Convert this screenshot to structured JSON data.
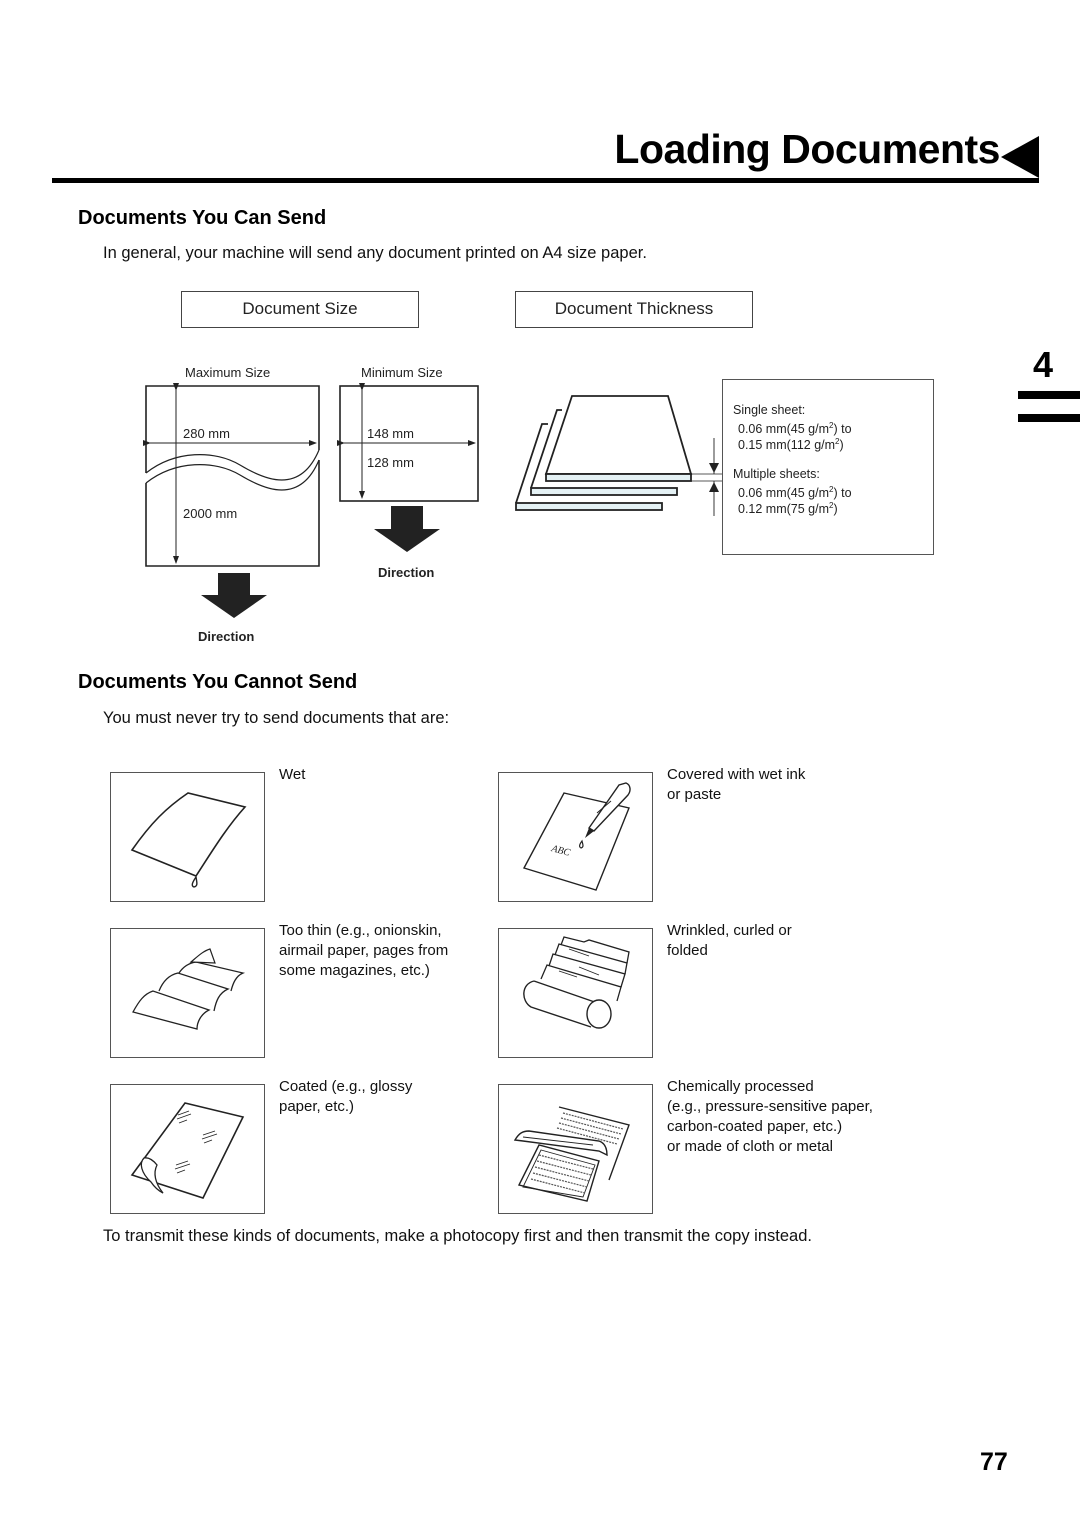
{
  "header": {
    "title": "Loading Documents",
    "chapter_tab": "4"
  },
  "section_can_send": {
    "heading": "Documents You Can Send",
    "intro": "In general, your machine will send any document printed on A4 size paper.",
    "size_box_label": "Document Size",
    "thickness_box_label": "Document Thickness",
    "maximum": {
      "label": "Maximum Size",
      "width": "280 mm",
      "length": "2000 mm",
      "direction_label": "Direction"
    },
    "minimum": {
      "label": "Minimum Size",
      "width": "148 mm",
      "length": "128 mm",
      "direction_label": "Direction"
    },
    "thickness": {
      "single_label": "Single sheet:",
      "single_line1_pre": "0.06 mm(45 g/m",
      "single_line1_post": ") to",
      "single_line2_pre": "0.15 mm(112 g/m",
      "single_line2_post": ")",
      "multiple_label": "Multiple sheets:",
      "multiple_line1_pre": "0.06 mm(45 g/m",
      "multiple_line1_post": ") to",
      "multiple_line2_pre": "0.12 mm(75 g/m",
      "multiple_line2_post": ")",
      "superscript": "2"
    }
  },
  "section_cannot_send": {
    "heading": "Documents You Cannot Send",
    "intro": "You must never try to send documents that are:",
    "items": [
      {
        "label": "Wet",
        "icon": "wet-paper-icon"
      },
      {
        "label": "Covered with wet ink\nor paste",
        "icon": "pen-ink-icon",
        "sample_text": "ABC"
      },
      {
        "label": "Too thin (e.g., onionskin,\nairmail paper, pages from\nsome magazines, etc.)",
        "icon": "thin-paper-icon"
      },
      {
        "label": "Wrinkled, curled or\nfolded",
        "icon": "wrinkled-paper-icon"
      },
      {
        "label": "Coated (e.g., glossy\npaper, etc.)",
        "icon": "coated-paper-icon"
      },
      {
        "label": "Chemically processed\n(e.g., pressure-sensitive paper,\ncarbon-coated paper, etc.)\nor made of cloth or metal",
        "icon": "carbon-paper-icon"
      }
    ],
    "footer_note": "To transmit these kinds of documents, make a photocopy first and then transmit the copy instead."
  },
  "footer": {
    "page_number": "77"
  }
}
